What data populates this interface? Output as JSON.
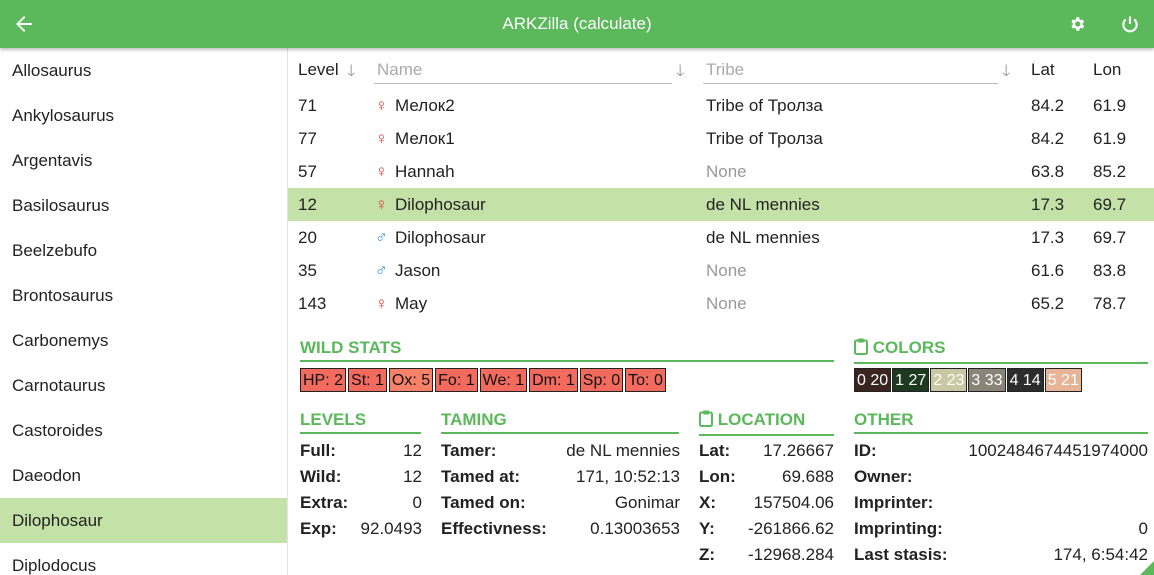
{
  "app": {
    "title": "ARKZilla (calculate)"
  },
  "sidebar": {
    "items": [
      "Allosaurus",
      "Ankylosaurus",
      "Argentavis",
      "Basilosaurus",
      "Beelzebufo",
      "Brontosaurus",
      "Carbonemys",
      "Carnotaurus",
      "Castoroides",
      "Daeodon",
      "Dilophosaur",
      "Diplodocus"
    ],
    "active_index": 10
  },
  "table": {
    "headers": {
      "level": "Level",
      "name_placeholder": "Name",
      "tribe_placeholder": "Tribe",
      "lat": "Lat",
      "lon": "Lon"
    },
    "rows": [
      {
        "level": "71",
        "sex": "♀",
        "name": "Мелок2",
        "tribe": "Tribe of Тролза",
        "lat": "84.2",
        "lon": "61.9"
      },
      {
        "level": "77",
        "sex": "♀",
        "name": "Мелок1",
        "tribe": "Tribe of Тролза",
        "lat": "84.2",
        "lon": "61.9"
      },
      {
        "level": "57",
        "sex": "♀",
        "name": "Hannah",
        "tribe": "None",
        "lat": "63.8",
        "lon": "85.2"
      },
      {
        "level": "12",
        "sex": "♀",
        "name": "Dilophosaur",
        "tribe": "de NL mennies",
        "lat": "17.3",
        "lon": "69.7"
      },
      {
        "level": "20",
        "sex": "♂",
        "name": "Dilophosaur",
        "tribe": "de NL mennies",
        "lat": "17.3",
        "lon": "69.7"
      },
      {
        "level": "35",
        "sex": "♂",
        "name": "Jason",
        "tribe": "None",
        "lat": "61.6",
        "lon": "83.8"
      },
      {
        "level": "143",
        "sex": "♀",
        "name": "May",
        "tribe": "None",
        "lat": "65.2",
        "lon": "78.7"
      }
    ],
    "selected_index": 3
  },
  "wild_stats": {
    "title": "WILD STATS",
    "items": [
      "HP: 2",
      "St: 1",
      "Ox: 5",
      "Fo: 1",
      "We: 1",
      "Dm: 1",
      "Sp: 0",
      "To: 0"
    ]
  },
  "colors": {
    "title": "COLORS",
    "items": [
      {
        "label": "0 20",
        "bg": "#3a2420",
        "fg": "#ffffff"
      },
      {
        "label": "1 27",
        "bg": "#1d3a20",
        "fg": "#ffffff"
      },
      {
        "label": "2 23",
        "bg": "#c9c8a5",
        "fg": "#ffffff"
      },
      {
        "label": "3 33",
        "bg": "#8a8378",
        "fg": "#ffffff"
      },
      {
        "label": "4 14",
        "bg": "#2c2c2c",
        "fg": "#ffffff"
      },
      {
        "label": "5 21",
        "bg": "#e8b497",
        "fg": "#ffffff"
      }
    ]
  },
  "levels": {
    "title": "LEVELS",
    "full_label": "Full:",
    "full": "12",
    "wild_label": "Wild:",
    "wild": "12",
    "extra_label": "Extra:",
    "extra": "0",
    "exp_label": "Exp:",
    "exp": "92.0493"
  },
  "taming": {
    "title": "TAMING",
    "tamer_label": "Tamer:",
    "tamer": "de NL mennies",
    "tamed_at_label": "Tamed at:",
    "tamed_at": "171, 10:52:13",
    "tamed_on_label": "Tamed on:",
    "tamed_on": "Gonimar",
    "eff_label": "Effectivness:",
    "eff": "0.13003653"
  },
  "location": {
    "title": "LOCATION",
    "lat_label": "Lat:",
    "lat": "17.26667",
    "lon_label": "Lon:",
    "lon": "69.688",
    "x_label": "X:",
    "x": "157504.06",
    "y_label": "Y:",
    "y": "-261866.62",
    "z_label": "Z:",
    "z": "-12968.284"
  },
  "other": {
    "title": "OTHER",
    "id_label": "ID:",
    "id": "1002484674451974000",
    "owner_label": "Owner:",
    "owner": "",
    "imprinter_label": "Imprinter:",
    "imprinter": "",
    "imprinting_label": "Imprinting:",
    "imprinting": "0",
    "stasis_label": "Last stasis:",
    "stasis": "174, 6:54:42"
  },
  "accent": "#5bb85b",
  "selection": "#c4e2a7"
}
